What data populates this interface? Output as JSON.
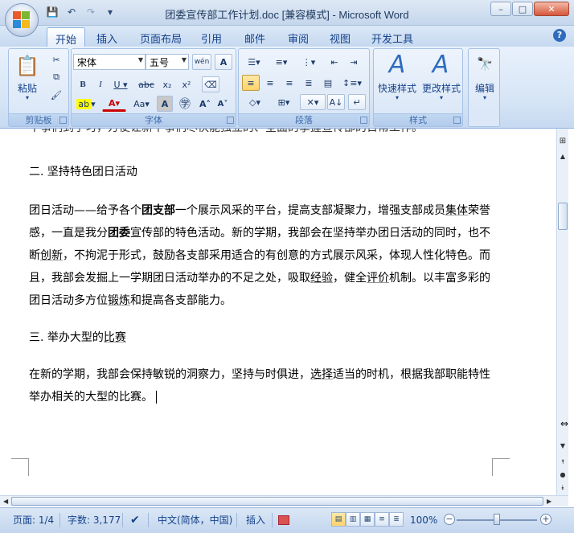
{
  "window": {
    "title": "团委宣传部工作计划.doc [兼容模式] - Microsoft Word",
    "minimize": "–",
    "maximize": "□",
    "close": "✕"
  },
  "qat": {
    "save": "💾",
    "undo": "↶",
    "redo": "↷",
    "more": "▾"
  },
  "tabs": [
    "开始",
    "插入",
    "页面布局",
    "引用",
    "邮件",
    "审阅",
    "视图",
    "开发工具"
  ],
  "ribbon": {
    "clipboard": {
      "title": "剪贴板",
      "paste": "粘贴"
    },
    "font": {
      "title": "字体",
      "font_name": "宋体",
      "font_size": "五号",
      "wen": "wén"
    },
    "paragraph": {
      "title": "段落"
    },
    "styles": {
      "title": "样式",
      "quick": "快速样式",
      "change": "更改样式"
    },
    "edit": {
      "label": "编辑"
    }
  },
  "document": {
    "cut_line": "干事们到学习，方便让新干事们尽快能独立的、全面的掌握宣传部的日常工作。",
    "heading2": "二. 坚持特色团日活动",
    "para1_parts": {
      "a": "团日活动——给予各个",
      "b": "团支部",
      "c": "一个展示风采的平台，提高支部凝聚力，增强支部成员",
      "d": "集体",
      "e": "荣誉感，一直是我分",
      "f": "团委",
      "g": "宣传部的特色活动。新的学期，我部会在坚持举办团日活动的同时，也不断",
      "h": "创新",
      "i": "，不拘泥于形式，鼓励各支部采用适合的有创意的方式展示风采，体现人性化特色。而且，我部会发掘上一学期团日活动举办的不足之处，吸取",
      "j": "经验",
      "k": "，健全",
      "l": "评价",
      "m": "机制。以丰富多彩的团日活动多方位",
      "n": "锻炼",
      "o": "和提高各支部能力。"
    },
    "heading3_a": "三. 举办大型的",
    "heading3_b": "比赛",
    "para2_a": "在新的学期，我部会保持敏锐的洞察力，坚持与时俱进，",
    "para2_b": "选择",
    "para2_c": "适当的时机，根据我部职能特性举办相关的大型的比赛。"
  },
  "status": {
    "page": "页面: 1/4",
    "words": "字数: 3,177",
    "language": "中文(简体，中国)",
    "mode": "插入",
    "zoom": "100%"
  }
}
